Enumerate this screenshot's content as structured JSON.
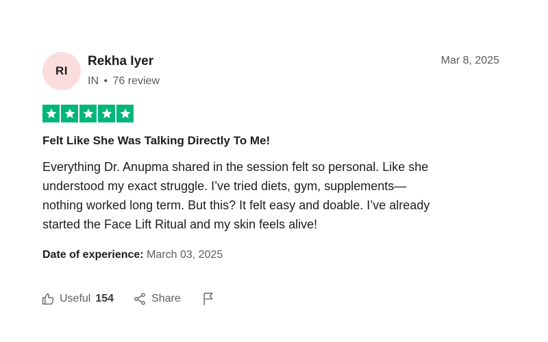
{
  "review": {
    "avatar_initials": "RI",
    "avatar_color": "#fbdcdf",
    "reviewer_name": "Rekha Iyer",
    "country": "IN",
    "separator": "•",
    "review_count": "76 review",
    "date": "Mar 8, 2025",
    "rating": 5,
    "star_color": "#00b67a",
    "title": "Felt Like She Was Talking Directly To Me!",
    "body_lines": [
      "Everything Dr. Anupma shared in the session felt so personal. Like she",
      "understood my exact struggle. I’ve tried diets, gym, supplements—",
      "nothing worked long term. But this? It felt easy and doable. I’ve already",
      "started the Face Lift Ritual and my skin feels alive!"
    ],
    "experience_label": "Date of experience:",
    "experience_date": "March 03, 2025"
  },
  "actions": {
    "useful_label": "Useful",
    "useful_count": "154",
    "useful_icon": "thumbs-up-icon",
    "share_label": "Share",
    "share_icon": "share-icon",
    "report_icon": "flag-icon"
  }
}
